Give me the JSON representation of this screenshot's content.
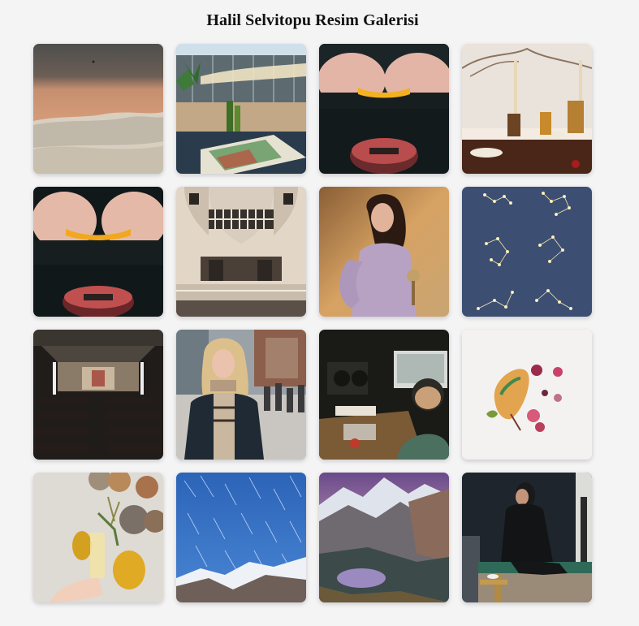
{
  "gallery": {
    "title": "Halil Selvitopu Resim Galerisi",
    "images": [
      {
        "subject": "beach-sand-waves"
      },
      {
        "subject": "rooftop-terrace-bottles-magazine"
      },
      {
        "subject": "hands-snapping-yellow-object-over-drink"
      },
      {
        "subject": "candlelit-dinner-table"
      },
      {
        "subject": "hands-snapping-yellow-object-over-drink-2"
      },
      {
        "subject": "building-facade-arches"
      },
      {
        "subject": "woman-lavender-dress-field"
      },
      {
        "subject": "zodiac-constellations-blue"
      },
      {
        "subject": "church-interior-pews"
      },
      {
        "subject": "blonde-woman-city-street"
      },
      {
        "subject": "man-at-music-studio-desk"
      },
      {
        "subject": "pressed-leaf-and-flowers"
      },
      {
        "subject": "party-balloons-champagne"
      },
      {
        "subject": "star-trails-over-mountains"
      },
      {
        "subject": "mountain-lake-sunset"
      },
      {
        "subject": "woman-sitting-dark-studio"
      }
    ]
  }
}
